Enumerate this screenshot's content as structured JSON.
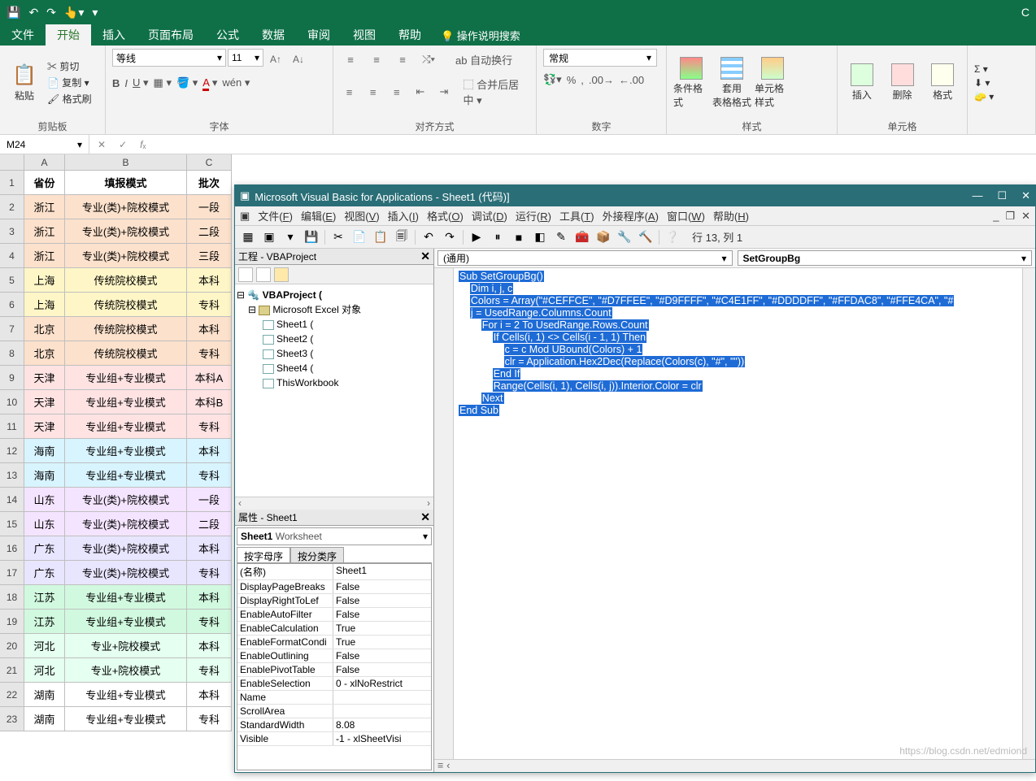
{
  "titlebar": {
    "corner": "C"
  },
  "ribbonTabs": [
    "文件",
    "开始",
    "插入",
    "页面布局",
    "公式",
    "数据",
    "审阅",
    "视图",
    "帮助"
  ],
  "activeTab": 1,
  "tellMe": "操作说明搜索",
  "clipboard": {
    "paste": "粘贴",
    "cut": "剪切",
    "copy": "复制",
    "brush": "格式刷",
    "label": "剪贴板"
  },
  "font": {
    "name": "等线",
    "size": "11",
    "label": "字体",
    "aa": "A  A",
    "wen": "wén"
  },
  "align": {
    "wrap": "自动换行",
    "merge": "合并后居中",
    "label": "对齐方式"
  },
  "number": {
    "format": "常规",
    "label": "数字"
  },
  "styles": {
    "cond": "条件格式",
    "table": "套用\n表格格式",
    "cell": "单元格样式",
    "label": "样式"
  },
  "cells": {
    "insert": "插入",
    "delete": "删除",
    "format": "格式",
    "label": "单元格"
  },
  "namebox": "M24",
  "cols": {
    "A": 50,
    "B": 150,
    "C": 55
  },
  "headers": {
    "A": "省份",
    "B": "填报模式",
    "C": "批次"
  },
  "data": [
    [
      "浙江",
      "专业(类)+院校模式",
      "一段",
      "#fce1cc"
    ],
    [
      "浙江",
      "专业(类)+院校模式",
      "二段",
      "#fce1cc"
    ],
    [
      "浙江",
      "专业(类)+院校模式",
      "三段",
      "#fce1cc"
    ],
    [
      "上海",
      "传统院校模式",
      "本科",
      "#fff6c7"
    ],
    [
      "上海",
      "传统院校模式",
      "专科",
      "#fff6c7"
    ],
    [
      "北京",
      "传统院校模式",
      "本科",
      "#fce1cc"
    ],
    [
      "北京",
      "传统院校模式",
      "专科",
      "#fce1cc"
    ],
    [
      "天津",
      "专业组+专业模式",
      "本科A",
      "#ffe3e3"
    ],
    [
      "天津",
      "专业组+专业模式",
      "本科B",
      "#ffe3e3"
    ],
    [
      "天津",
      "专业组+专业模式",
      "专科",
      "#ffe3e3"
    ],
    [
      "海南",
      "专业组+专业模式",
      "本科",
      "#d8f4ff"
    ],
    [
      "海南",
      "专业组+专业模式",
      "专科",
      "#d8f4ff"
    ],
    [
      "山东",
      "专业(类)+院校模式",
      "一段",
      "#f4e4ff"
    ],
    [
      "山东",
      "专业(类)+院校模式",
      "二段",
      "#f4e4ff"
    ],
    [
      "广东",
      "专业(类)+院校模式",
      "本科",
      "#e8e5ff"
    ],
    [
      "广东",
      "专业(类)+院校模式",
      "专科",
      "#e8e5ff"
    ],
    [
      "江苏",
      "专业组+专业模式",
      "本科",
      "#d1f9df"
    ],
    [
      "江苏",
      "专业组+专业模式",
      "专科",
      "#d1f9df"
    ],
    [
      "河北",
      "专业+院校模式",
      "本科",
      "#e5fff0"
    ],
    [
      "河北",
      "专业+院校模式",
      "专科",
      "#e5fff0"
    ],
    [
      "湖南",
      "专业组+专业模式",
      "本科",
      "#ffffff"
    ],
    [
      "湖南",
      "专业组+专业模式",
      "专科",
      "#ffffff"
    ]
  ],
  "vba": {
    "title": "Microsoft Visual Basic for Applications -                                           Sheet1 (代码)]",
    "menus": [
      "文件(F)",
      "编辑(E)",
      "视图(V)",
      "插入(I)",
      "格式(O)",
      "调试(D)",
      "运行(R)",
      "工具(T)",
      "外接程序(A)",
      "窗口(W)",
      "帮助(H)"
    ],
    "tbIcons": [
      "▦",
      "▣",
      "▾",
      "💾",
      "",
      "✂",
      "📄",
      "📋",
      "🗐",
      "",
      "↶",
      "↷",
      "",
      "▶",
      "⏸",
      "■",
      "◧",
      "✎",
      "🧰",
      "📦",
      "🔧",
      "🔨",
      "",
      "❔"
    ],
    "pos": "行 13, 列 1",
    "projTitle": "工程 - VBAProject",
    "tree": {
      "root": "VBAProject (",
      "folder": "Microsoft Excel 对象",
      "sheets": [
        "Sheet1 (",
        "Sheet2 (",
        "Sheet3 (",
        "Sheet4 ("
      ],
      "wb": "ThisWorkbook"
    },
    "propsTitle": "属性 - Sheet1",
    "propsObj": "Sheet1 Worksheet",
    "propTabs": [
      "按字母序",
      "按分类序"
    ],
    "props": [
      [
        "(名称)",
        "Sheet1"
      ],
      [
        "DisplayPageBreaks",
        "False"
      ],
      [
        "DisplayRightToLef",
        "False"
      ],
      [
        "EnableAutoFilter",
        "False"
      ],
      [
        "EnableCalculation",
        "True"
      ],
      [
        "EnableFormatCondi",
        "True"
      ],
      [
        "EnableOutlining",
        "False"
      ],
      [
        "EnablePivotTable",
        "False"
      ],
      [
        "EnableSelection",
        "0 - xlNoRestrict"
      ],
      [
        "Name",
        ""
      ],
      [
        "ScrollArea",
        ""
      ],
      [
        "StandardWidth",
        "8.08"
      ],
      [
        "Visible",
        "-1 - xlSheetVisi"
      ]
    ],
    "ddLeft": "(通用)",
    "ddRight": "SetGroupBg",
    "code": [
      [
        "Sub SetGroupBg()",
        0
      ],
      [
        "Dim i, j, c",
        1
      ],
      [
        "Colors = Array(\"#CEFFCE\", \"#D7FFEE\", \"#D9FFFF\", \"#C4E1FF\", \"#DDDDFF\", \"#FFDAC8\", \"#FFE4CA\", \"#",
        1
      ],
      [
        "j = UsedRange.Columns.Count",
        1
      ],
      [
        "For i = 2 To UsedRange.Rows.Count",
        2
      ],
      [
        "If Cells(i, 1) <> Cells(i - 1, 1) Then",
        3
      ],
      [
        "c = c Mod UBound(Colors) + 1",
        4
      ],
      [
        "clr = Application.Hex2Dec(Replace(Colors(c), \"#\", \"\"))",
        4
      ],
      [
        "End If",
        3
      ],
      [
        "Range(Cells(i, 1), Cells(i, j)).Interior.Color = clr",
        3
      ],
      [
        "Next",
        2
      ],
      [
        "End Sub",
        0
      ]
    ]
  },
  "watermark": "https://blog.csdn.net/edmiond"
}
